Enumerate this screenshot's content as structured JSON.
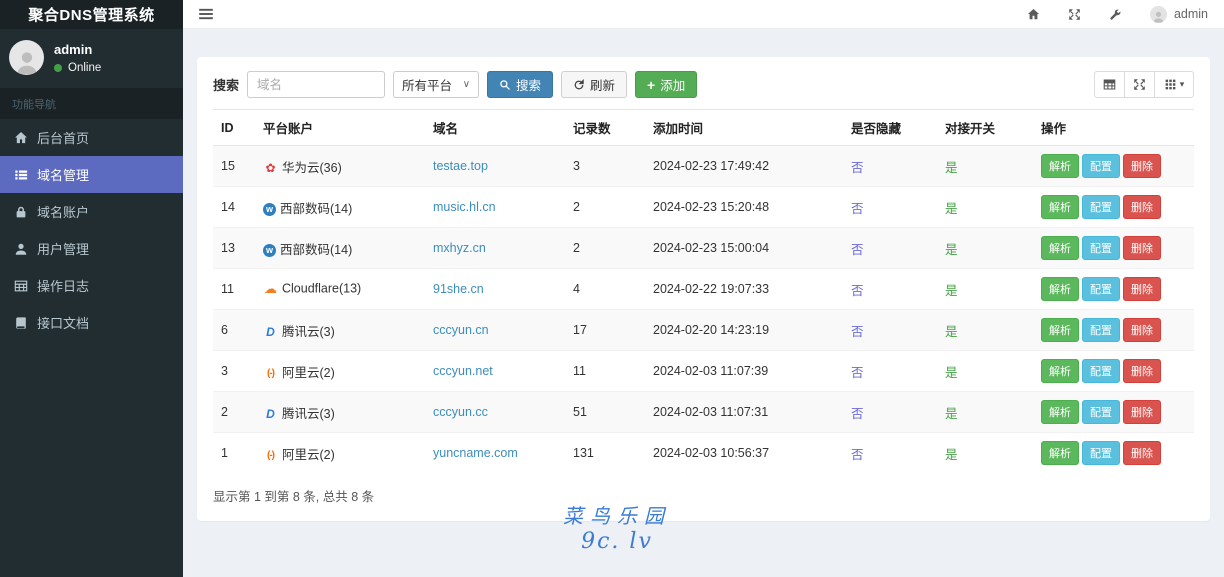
{
  "brand": {
    "title": "聚合DNS管理系统"
  },
  "navbar": {
    "username": "admin"
  },
  "sidebar": {
    "user": {
      "name": "admin",
      "status": "Online"
    },
    "section_label": "功能导航",
    "items": [
      {
        "key": "home",
        "icon": "home",
        "label": "后台首页",
        "active": false
      },
      {
        "key": "domains",
        "icon": "list",
        "label": "域名管理",
        "active": true
      },
      {
        "key": "accounts",
        "icon": "lock",
        "label": "域名账户",
        "active": false
      },
      {
        "key": "users",
        "icon": "user",
        "label": "用户管理",
        "active": false
      },
      {
        "key": "logs",
        "icon": "log",
        "label": "操作日志",
        "active": false
      },
      {
        "key": "apidoc",
        "icon": "book",
        "label": "接口文档",
        "active": false
      }
    ]
  },
  "toolbar": {
    "search_label": "搜索",
    "search_placeholder": "域名",
    "platform_select": "所有平台",
    "search_button": "搜索",
    "refresh_button": "刷新",
    "add_button": "添加"
  },
  "icons": {
    "plus": "+",
    "caret": "▾"
  },
  "platform_icons": {
    "huawei": "✿",
    "west": "w",
    "cloudflare": "☁",
    "dnspod": "D",
    "aliyun": "(-)"
  },
  "table": {
    "columns": [
      "ID",
      "平台账户",
      "域名",
      "记录数",
      "添加时间",
      "是否隐藏",
      "对接开关",
      "操作"
    ],
    "actions": {
      "resolve": "解析",
      "config": "配置",
      "delete": "删除"
    },
    "rows": [
      {
        "id": "15",
        "platform_icon": "huawei",
        "platform": "华为云(36)",
        "domain": "testae.top",
        "records": "3",
        "created": "2024-02-23 17:49:42",
        "hidden": "否",
        "enabled": "是"
      },
      {
        "id": "14",
        "platform_icon": "west",
        "platform": "西部数码(14)",
        "domain": "music.hl.cn",
        "records": "2",
        "created": "2024-02-23 15:20:48",
        "hidden": "否",
        "enabled": "是"
      },
      {
        "id": "13",
        "platform_icon": "west",
        "platform": "西部数码(14)",
        "domain": "mxhyz.cn",
        "records": "2",
        "created": "2024-02-23 15:00:04",
        "hidden": "否",
        "enabled": "是"
      },
      {
        "id": "11",
        "platform_icon": "cloudflare",
        "platform": "Cloudflare(13)",
        "domain": "91she.cn",
        "records": "4",
        "created": "2024-02-22 19:07:33",
        "hidden": "否",
        "enabled": "是"
      },
      {
        "id": "6",
        "platform_icon": "dnspod",
        "platform": "腾讯云(3)",
        "domain": "cccyun.cn",
        "records": "17",
        "created": "2024-02-20 14:23:19",
        "hidden": "否",
        "enabled": "是"
      },
      {
        "id": "3",
        "platform_icon": "aliyun",
        "platform": "阿里云(2)",
        "domain": "cccyun.net",
        "records": "11",
        "created": "2024-02-03 11:07:39",
        "hidden": "否",
        "enabled": "是"
      },
      {
        "id": "2",
        "platform_icon": "dnspod",
        "platform": "腾讯云(3)",
        "domain": "cccyun.cc",
        "records": "51",
        "created": "2024-02-03 11:07:31",
        "hidden": "否",
        "enabled": "是"
      },
      {
        "id": "1",
        "platform_icon": "aliyun",
        "platform": "阿里云(2)",
        "domain": "yuncname.com",
        "records": "131",
        "created": "2024-02-03 10:56:37",
        "hidden": "否",
        "enabled": "是"
      }
    ]
  },
  "pagination": {
    "summary": "显示第 1 到第 8 条, 总共 8 条"
  },
  "watermark": {
    "line1": "菜鸟乐园",
    "line2": "9c. lv"
  }
}
